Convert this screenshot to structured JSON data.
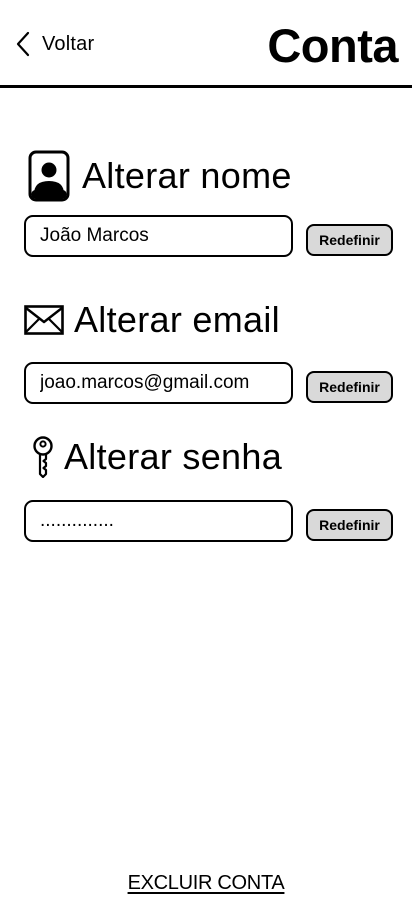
{
  "header": {
    "back_label": "Voltar",
    "title": "Conta"
  },
  "name_section": {
    "heading": "Alterar nome",
    "icon": "contact-card-icon",
    "value": "João Marcos",
    "button": "Redefinir"
  },
  "email_section": {
    "heading": "Alterar email",
    "icon": "envelope-icon",
    "value": "joao.marcos@gmail.com",
    "button": "Redefinir"
  },
  "password_section": {
    "heading": "Alterar senha",
    "icon": "key-icon",
    "value": "..............",
    "button": "Redefinir"
  },
  "footer": {
    "delete_label": "EXCLUIR CONTA"
  }
}
